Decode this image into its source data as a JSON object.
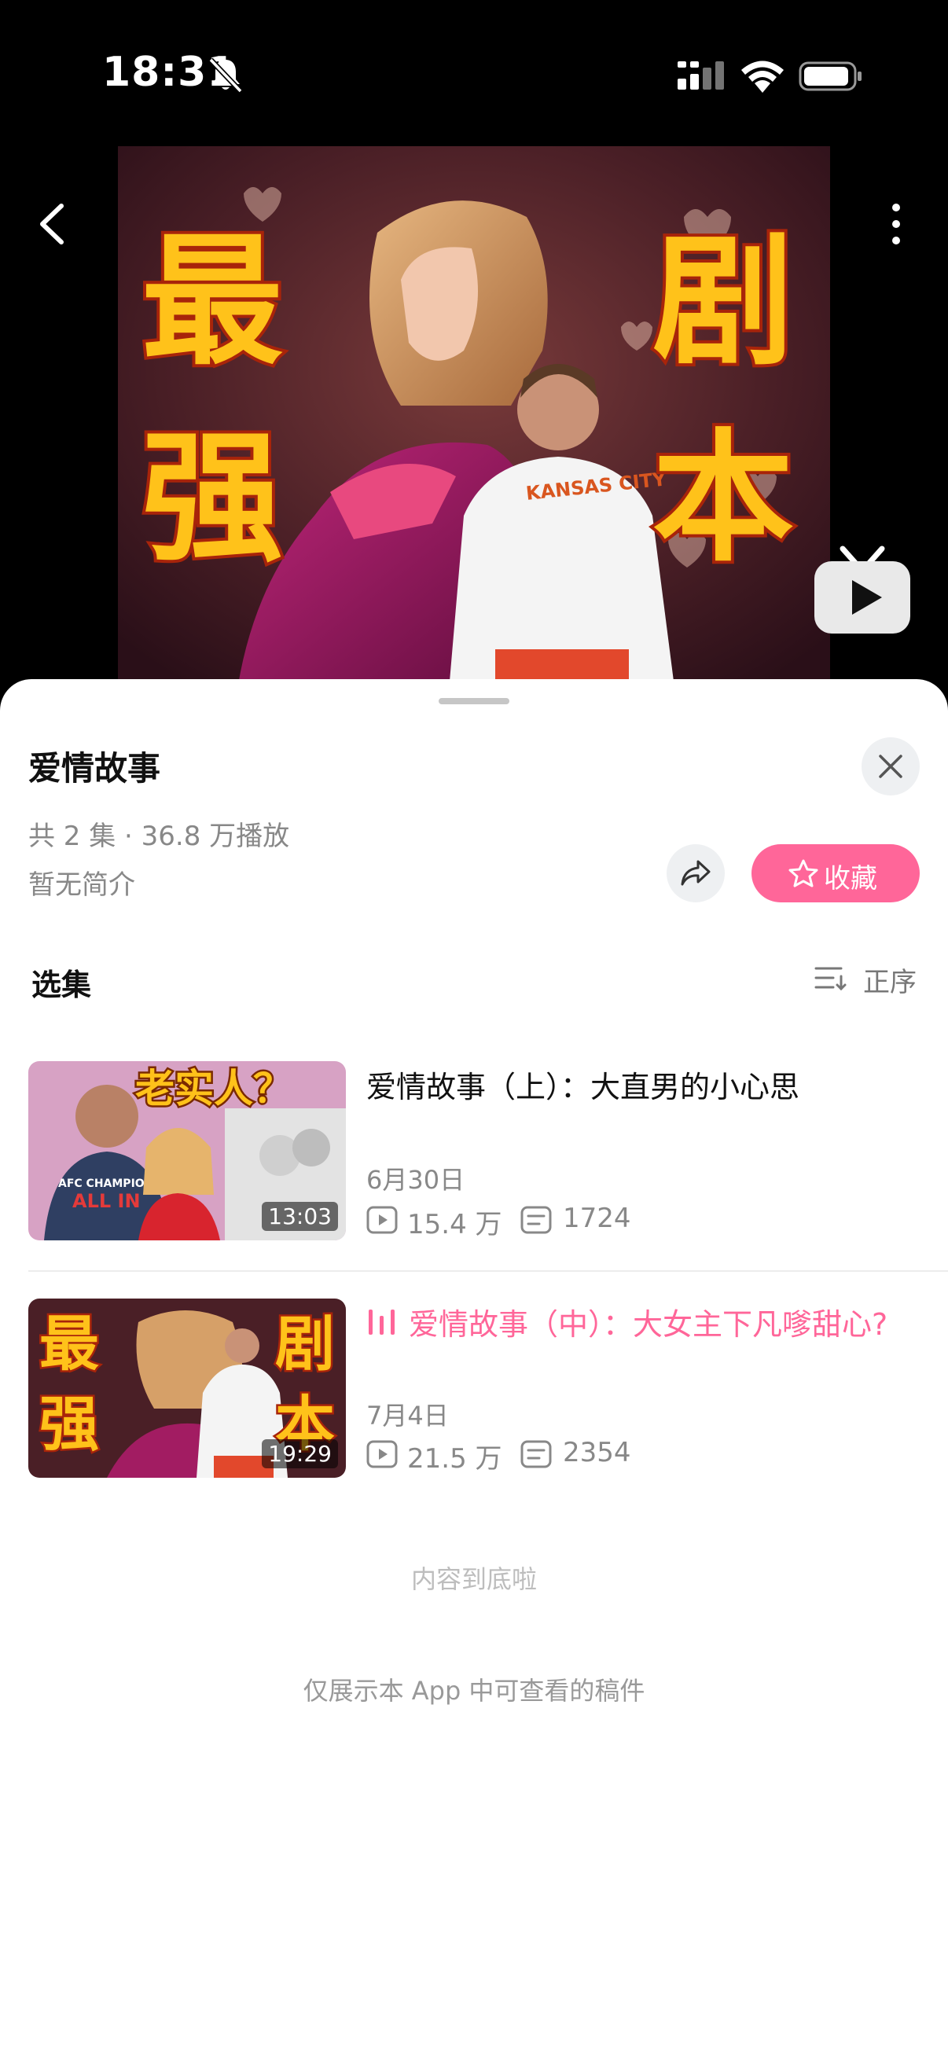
{
  "status_bar": {
    "time": "18:31"
  },
  "video": {
    "cover_chars_left": [
      "最",
      "强"
    ],
    "cover_chars_right": [
      "剧",
      "本"
    ],
    "shirt_text": "KANSAS CITY"
  },
  "collection": {
    "title": "爱情故事",
    "meta": "共 2 集 · 36.8 万播放",
    "intro": "暂无简介",
    "favorite_label": "收藏",
    "accent_color": "#ff6699"
  },
  "episode_section": {
    "title": "选集",
    "order_label": "正序"
  },
  "episodes": [
    {
      "title": "爱情故事（上）：大直男的小心思",
      "date": "6月30日",
      "views": "15.4 万",
      "comments": "1724",
      "duration": "13:03",
      "thumb_caption": "老实人？",
      "thumb_shirt_line1": "AFC CHAMPIONS",
      "thumb_shirt_line2": "ALL IN",
      "playing": false
    },
    {
      "title": "爱情故事（中）：大女主下凡嗲甜心?",
      "date": "7月4日",
      "views": "21.5 万",
      "comments": "2354",
      "duration": "19:29",
      "thumb_chars": [
        "最",
        "强",
        "剧",
        "本"
      ],
      "playing": true
    }
  ],
  "end_note": "内容到底啦",
  "footer_note": "仅展示本 App 中可查看的稿件"
}
